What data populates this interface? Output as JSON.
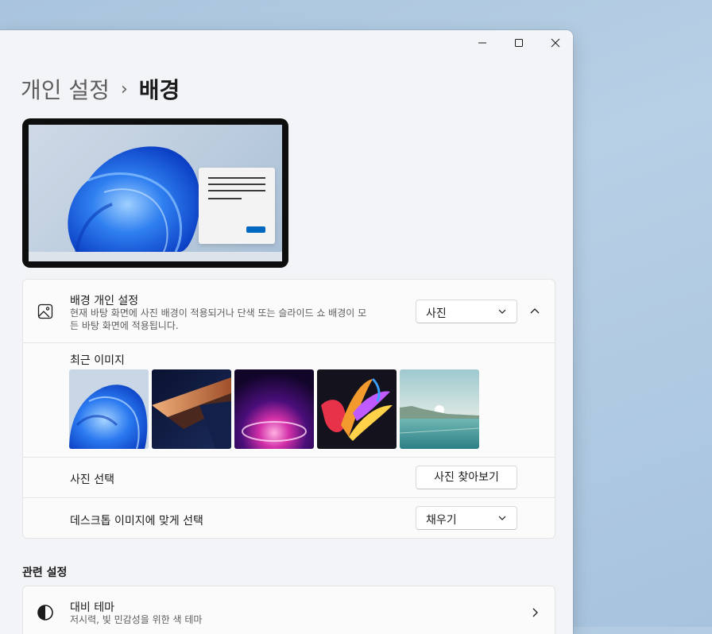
{
  "window": {
    "caption": {
      "minimize": "minimize-icon",
      "maximize": "maximize-icon",
      "close": "close-icon"
    }
  },
  "breadcrumb": {
    "parent": "개인 설정",
    "separator": "›",
    "current": "배경"
  },
  "background_setting": {
    "title": "배경 개인 설정",
    "description_line1": "현재 바탕 화면에 사진 배경이 적용되거나 단색 또는 슬라이드 쇼 배경이 모",
    "description_line2": "든 바탕 화면에 적용됩니다.",
    "selected": "사진",
    "icon": "image-icon",
    "expanded": true
  },
  "recent_images": {
    "label": "최근 이미지",
    "thumbnails": [
      "bloom-blue",
      "bronze-glass",
      "purple-glow",
      "ribbon-colorful",
      "lake-sunrise"
    ]
  },
  "choose_photo": {
    "label": "사진 선택",
    "button": "사진 찾아보기"
  },
  "fit": {
    "label": "데스크톱 이미지에 맞게 선택",
    "selected": "채우기"
  },
  "related": {
    "header": "관련 설정",
    "contrast_title": "대비 테마",
    "contrast_desc": "저시력, 빛 민감성을 위한 색 테마",
    "icon": "contrast-icon"
  },
  "colors": {
    "accent": "#0067c0",
    "window_bg": "#f3f4f8",
    "card_bg": "#fbfbfc"
  }
}
